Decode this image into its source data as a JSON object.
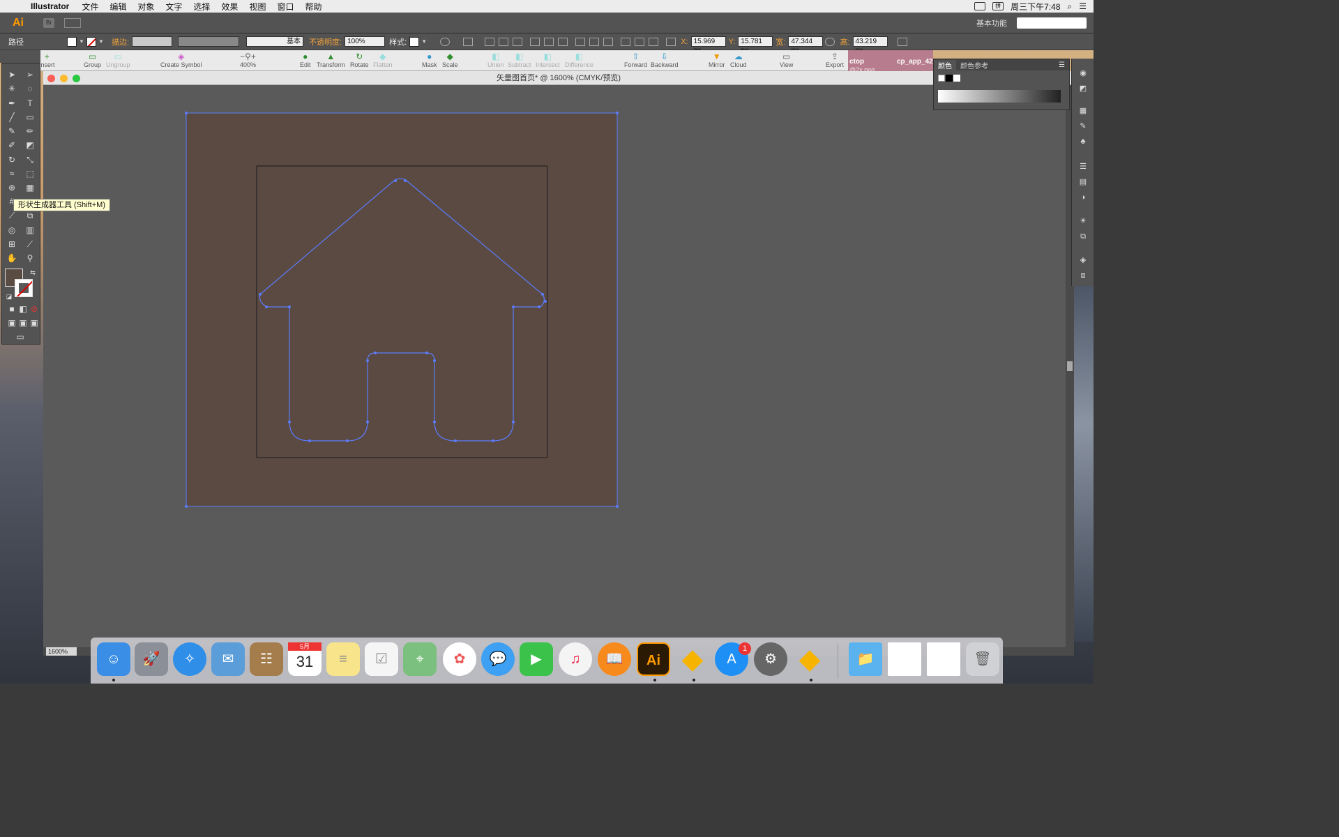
{
  "menubar": {
    "app": "Illustrator",
    "items": [
      "文件",
      "编辑",
      "对象",
      "文字",
      "选择",
      "效果",
      "视图",
      "窗口",
      "帮助"
    ],
    "clock": "周三下午7:48"
  },
  "appbar": {
    "logo": "Ai",
    "bridge": "Br",
    "workspace": "基本功能"
  },
  "controlbar": {
    "selection_label": "路径",
    "stroke_label": "描边:",
    "stroke_style": "基本",
    "opacity_label": "不透明度:",
    "opacity_value": "100%",
    "style_label": "样式:",
    "x_label": "X:",
    "x_value": "15.969 px",
    "y_label": "Y:",
    "y_value": "15.781 px",
    "w_label": "宽:",
    "w_value": "47.344 px",
    "h_label": "高:",
    "h_value": "43.219 px"
  },
  "ribbon": {
    "items": [
      "Insert",
      "Group",
      "Ungroup",
      "Create Symbol",
      "400%",
      "Edit",
      "Transform",
      "Rotate",
      "Flatten",
      "Mask",
      "Scale",
      "Union",
      "Subtract",
      "Intersect",
      "Difference",
      "Forward",
      "Backward",
      "Mirror",
      "Cloud",
      "View",
      "Export"
    ]
  },
  "doctabs": {
    "tab1": "ctop",
    "tab1_sub": "@2x.png",
    "tab2": "cp_app_42"
  },
  "document": {
    "title": "矢量图首页* @ 1600% (CMYK/预览)",
    "zoom": "1600%",
    "artboard_fill": "#5b4a41",
    "path_color": "#5b7cff"
  },
  "tooltip": "形状生成器工具 (Shift+M)",
  "colorpanel": {
    "tab_color": "颜色",
    "tab_guide": "颜色参考"
  },
  "dock": {
    "apps": [
      "Finder",
      "Launchpad",
      "Safari",
      "Mail",
      "Contacts",
      "Calendar",
      "Notes",
      "Reminders",
      "Maps",
      "Photos",
      "Messages",
      "FaceTime",
      "iTunes",
      "iBooks",
      "Illustrator",
      "Sketch",
      "App Store",
      "System Preferences",
      "Sketch",
      "Downloads",
      "File",
      "File",
      "Trash"
    ],
    "calendar_month": "5月",
    "calendar_day": "31",
    "appstore_badge": "1"
  }
}
